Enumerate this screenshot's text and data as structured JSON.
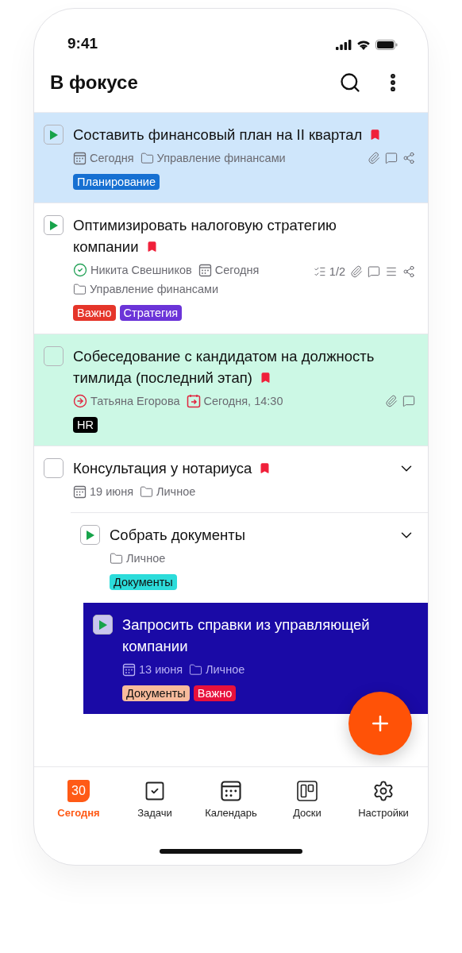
{
  "status_bar": {
    "time": "9:41"
  },
  "header": {
    "title": "В фокусе"
  },
  "tasks": [
    {
      "title": "Составить финансовый план на II квартал",
      "in_progress": true,
      "flagged": true,
      "color": "#cfe6fb",
      "meta": [
        {
          "kind": "date",
          "text": "Сегодня"
        },
        {
          "kind": "folder",
          "text": "Управление финансами"
        }
      ],
      "extras": [
        {
          "kind": "attachment"
        },
        {
          "kind": "comment"
        },
        {
          "kind": "share"
        }
      ],
      "tags": [
        {
          "text": "Планирование",
          "color": "#1670d2"
        }
      ]
    },
    {
      "title": "Оптимизировать налоговую стратегию компании",
      "in_progress": true,
      "flagged": true,
      "color": "#ffffff",
      "meta": [
        {
          "kind": "assignee_done",
          "text": "Никита Свешников"
        },
        {
          "kind": "date",
          "text": "Сегодня"
        },
        {
          "kind": "folder",
          "text": "Управление финансами"
        }
      ],
      "extras": [
        {
          "kind": "checklist",
          "text": "1/2"
        },
        {
          "kind": "attachment"
        },
        {
          "kind": "comment"
        },
        {
          "kind": "notes"
        },
        {
          "kind": "share"
        }
      ],
      "tags": [
        {
          "text": "Важно",
          "color": "#e5352a"
        },
        {
          "text": "Стратегия",
          "color": "#6b34d8"
        }
      ]
    },
    {
      "title": "Собеседование с кандидатом на должность тимлида (последний этап)",
      "in_progress": false,
      "flagged": true,
      "color": "#ccf8e5",
      "meta": [
        {
          "kind": "assignee_delegated",
          "text": "Татьяна Егорова"
        },
        {
          "kind": "reminder",
          "text": "Сегодня, 14:30"
        }
      ],
      "extras": [
        {
          "kind": "attachment"
        },
        {
          "kind": "comment"
        }
      ],
      "tags": [
        {
          "text": "HR",
          "color": "#000000"
        }
      ]
    },
    {
      "title": "Консультация у нотариуса",
      "in_progress": false,
      "flagged": true,
      "color": "#ffffff",
      "expanded": true,
      "meta": [
        {
          "kind": "date",
          "text": "19 июня"
        },
        {
          "kind": "folder",
          "text": "Личное"
        }
      ],
      "children": [
        {
          "title": "Собрать документы",
          "in_progress": true,
          "flagged": false,
          "color": "#ffffff",
          "expanded": true,
          "meta": [
            {
              "kind": "folder",
              "text": "Личное"
            }
          ],
          "tags": [
            {
              "text": "Документы",
              "color": "#2cdcda"
            }
          ],
          "children": [
            {
              "title": "Запросить справки из управляющей компании",
              "in_progress": true,
              "flagged": false,
              "color": "#1a0aa6",
              "meta": [
                {
                  "kind": "date",
                  "text": "13 июня"
                },
                {
                  "kind": "folder",
                  "text": "Личное"
                }
              ],
              "tags": [
                {
                  "text": "Документы",
                  "color": "#f8bb9c"
                },
                {
                  "text": "Важно",
                  "color": "#e8113c"
                }
              ]
            }
          ]
        }
      ]
    }
  ],
  "tab_bar": [
    {
      "kind": "today",
      "label": "Сегодня",
      "icon_text": "30",
      "selected": true
    },
    {
      "kind": "tasks",
      "label": "Задачи",
      "selected": false
    },
    {
      "kind": "calendar",
      "label": "Календарь",
      "selected": false
    },
    {
      "kind": "boards",
      "label": "Доски",
      "selected": false
    },
    {
      "kind": "settings",
      "label": "Настройки",
      "selected": false
    }
  ]
}
